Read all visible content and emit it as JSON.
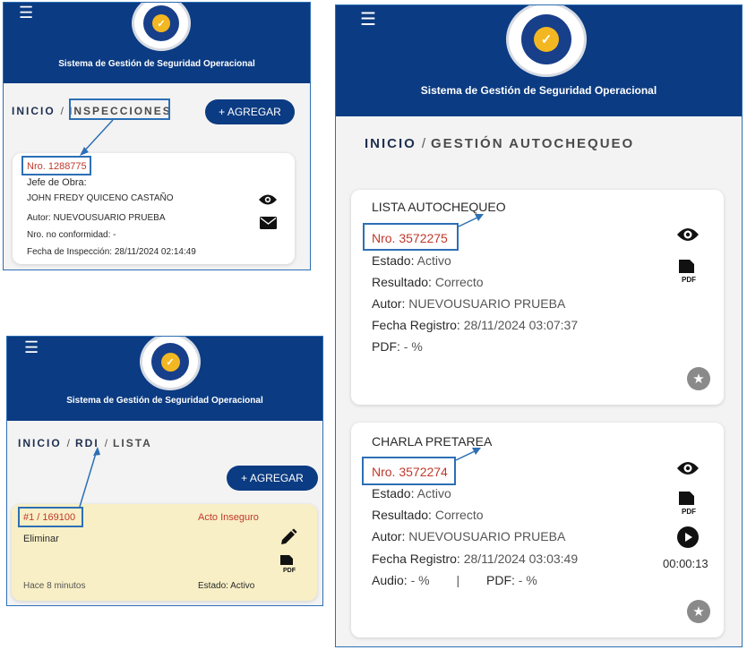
{
  "app": {
    "title": "Sistema de Gestión de Seguridad Operacional"
  },
  "icons": {
    "menu": "hamburger-icon",
    "logo": "logo-icon",
    "view": "eye-icon",
    "mail": "envelope-icon",
    "pdf": "pdf-icon",
    "edit": "pencil-icon",
    "play": "play-icon",
    "star": "star-icon"
  },
  "colors": {
    "header": "#0b3b82",
    "accent_red": "#c0392b",
    "highlight": "#2d6fb5",
    "rdi_card": "#f8efc6"
  },
  "inspecciones": {
    "breadcrumb": {
      "home": "INICIO",
      "sep": "/",
      "current": "INSPECCIONES"
    },
    "add_button": "+ AGREGAR",
    "card": {
      "number": "Nro. 1288775",
      "jefe_label": "Jefe de Obra:",
      "jefe_value": "JOHN FREDY QUICENO CASTAÑO",
      "autor": "Autor: NUEVOUSUARIO PRUEBA",
      "no_conformidad": "Nro. no conformidad: -",
      "fecha": "Fecha de Inspección: 28/11/2024 02:14:49"
    }
  },
  "rdi": {
    "breadcrumb": {
      "home": "INICIO",
      "sep1": "/",
      "mid": "RDI",
      "sep2": "/",
      "current": "LISTA"
    },
    "add_button": "+ AGREGAR",
    "card": {
      "number": "#1 / 169100",
      "type": "Acto Inseguro",
      "action": "Eliminar",
      "time": "Hace 8 minutos",
      "estado": "Estado: Activo"
    }
  },
  "autochequeo": {
    "breadcrumb": {
      "home": "INICIO",
      "sep": "/",
      "current": "GESTIÓN AUTOCHEQUEO"
    },
    "cards": [
      {
        "title": "LISTA AUTOCHEQUEO",
        "number": "Nro. 3572275",
        "estado_label": "Estado:",
        "estado_value": "Activo",
        "resultado_label": "Resultado:",
        "resultado_value": "Correcto",
        "autor_label": "Autor:",
        "autor_value": "NUEVOUSUARIO PRUEBA",
        "fecha_label": "Fecha Registro:",
        "fecha_value": "28/11/2024 03:07:37",
        "pdf_label": "PDF:",
        "pdf_value": "- %"
      },
      {
        "title": "CHARLA PRETAREA",
        "number": "Nro. 3572274",
        "estado_label": "Estado:",
        "estado_value": "Activo",
        "resultado_label": "Resultado:",
        "resultado_value": "Correcto",
        "autor_label": "Autor:",
        "autor_value": "NUEVOUSUARIO PRUEBA",
        "fecha_label": "Fecha Registro:",
        "fecha_value": "28/11/2024 03:03:49",
        "audio_label": "Audio:",
        "audio_value": "- %",
        "divider": "|",
        "pdf_label": "PDF:",
        "pdf_value": "- %",
        "duration": "00:00:13"
      }
    ]
  }
}
